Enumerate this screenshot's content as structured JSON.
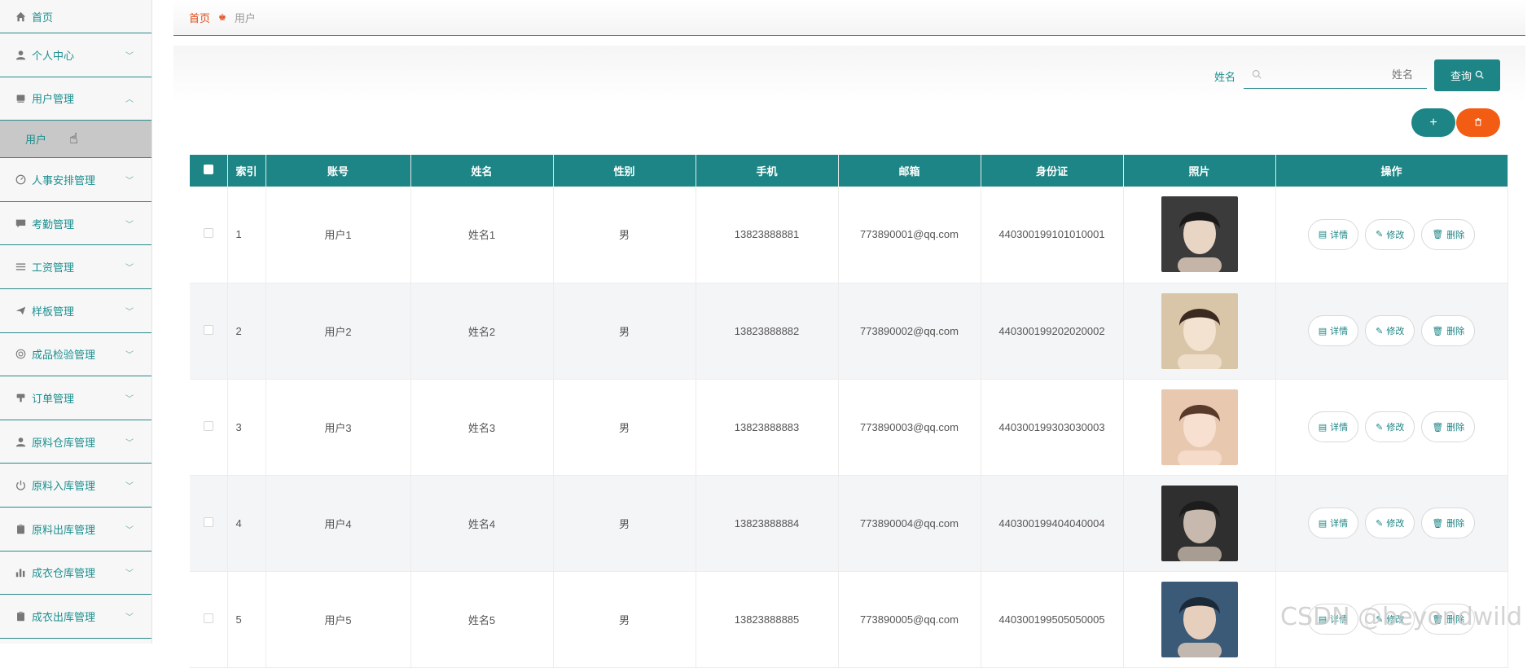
{
  "sidebar": {
    "items": [
      {
        "label": "首页",
        "icon": "home-icon"
      },
      {
        "label": "个人中心",
        "icon": "user-icon"
      },
      {
        "label": "用户管理",
        "icon": "folder-icon",
        "expanded": true,
        "sub": [
          {
            "label": "用户"
          }
        ]
      },
      {
        "label": "人事安排管理",
        "icon": "gauge-icon"
      },
      {
        "label": "考勤管理",
        "icon": "chat-icon"
      },
      {
        "label": "工资管理",
        "icon": "list-icon"
      },
      {
        "label": "样板管理",
        "icon": "send-icon"
      },
      {
        "label": "成品检验管理",
        "icon": "target-icon"
      },
      {
        "label": "订单管理",
        "icon": "stamp-icon"
      },
      {
        "label": "原料仓库管理",
        "icon": "user-icon"
      },
      {
        "label": "原料入库管理",
        "icon": "power-icon"
      },
      {
        "label": "原料出库管理",
        "icon": "clipboard-icon"
      },
      {
        "label": "成衣仓库管理",
        "icon": "bar-chart-icon"
      },
      {
        "label": "成衣出库管理",
        "icon": "clipboard-icon"
      }
    ]
  },
  "breadcrumb": {
    "home": "首页",
    "current": "用户"
  },
  "search": {
    "label": "姓名",
    "placeholder": "姓名",
    "button": "查询"
  },
  "actions": {
    "add": "+",
    "delete": "🗑"
  },
  "table": {
    "headers": [
      "索引",
      "账号",
      "姓名",
      "性别",
      "手机",
      "邮箱",
      "身份证",
      "照片",
      "操作"
    ],
    "rows": [
      {
        "idx": "1",
        "account": "用户1",
        "name": "姓名1",
        "gender": "男",
        "phone": "13823888881",
        "email": "773890001@qq.com",
        "id": "440300199101010001"
      },
      {
        "idx": "2",
        "account": "用户2",
        "name": "姓名2",
        "gender": "男",
        "phone": "13823888882",
        "email": "773890002@qq.com",
        "id": "440300199202020002"
      },
      {
        "idx": "3",
        "account": "用户3",
        "name": "姓名3",
        "gender": "男",
        "phone": "13823888883",
        "email": "773890003@qq.com",
        "id": "440300199303030003"
      },
      {
        "idx": "4",
        "account": "用户4",
        "name": "姓名4",
        "gender": "男",
        "phone": "13823888884",
        "email": "773890004@qq.com",
        "id": "440300199404040004"
      },
      {
        "idx": "5",
        "account": "用户5",
        "name": "姓名5",
        "gender": "男",
        "phone": "13823888885",
        "email": "773890005@qq.com",
        "id": "440300199505050005"
      }
    ],
    "ops": {
      "detail": "详情",
      "edit": "修改",
      "remove": "删除"
    }
  },
  "watermark": "CSDN @beyondwild",
  "colors": {
    "primary": "#1d8585",
    "danger": "#f25c13"
  }
}
